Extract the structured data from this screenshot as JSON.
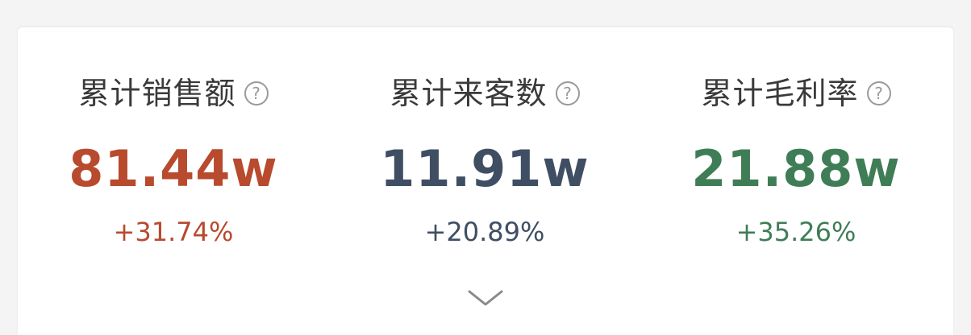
{
  "metrics": [
    {
      "label": "累计销售额",
      "value": "81.44w",
      "change": "+31.74%",
      "color": "#b84a2e",
      "help_icon": "question-circle-icon"
    },
    {
      "label": "累计来客数",
      "value": "11.91w",
      "change": "+20.89%",
      "color": "#3f4e63",
      "help_icon": "question-circle-icon"
    },
    {
      "label": "累计毛利率",
      "value": "21.88w",
      "change": "+35.26%",
      "color": "#3f7d56",
      "help_icon": "question-circle-icon"
    }
  ],
  "expand_icon": "chevron-down-icon",
  "help_glyph": "?"
}
